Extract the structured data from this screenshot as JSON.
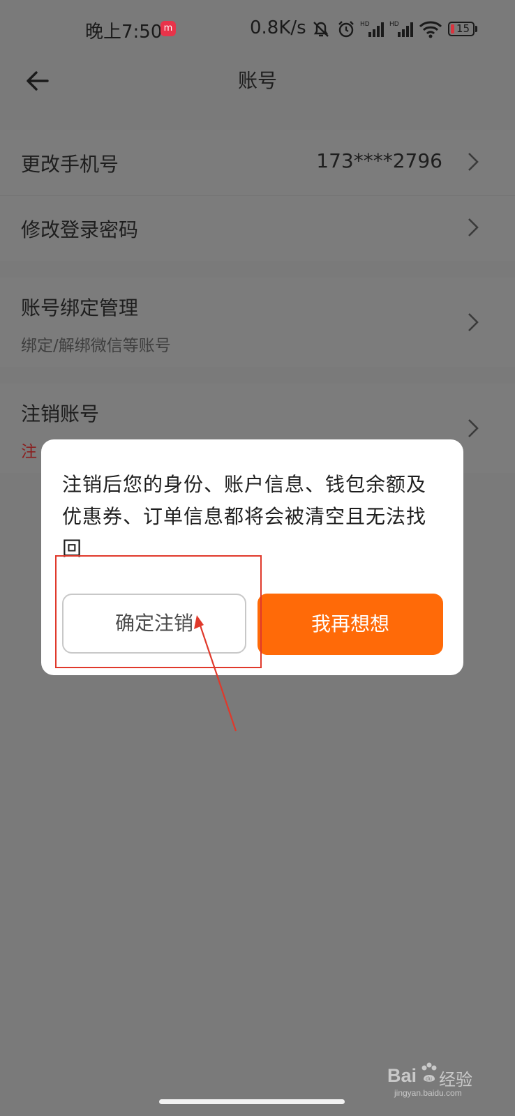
{
  "status_bar": {
    "time": "晚上7:50",
    "app_badge": "m",
    "net_speed": "0.8K/s",
    "battery_level": "15",
    "icons": [
      "mute-bell-icon",
      "alarm-icon",
      "hd-signal-icon",
      "hd-signal-icon",
      "wifi-icon",
      "battery-icon"
    ]
  },
  "nav": {
    "title": "账号",
    "back_icon": "back-arrow-icon"
  },
  "rows": {
    "phone": {
      "label": "更改手机号",
      "value": "173****2796"
    },
    "password": {
      "label": "修改登录密码"
    },
    "binding": {
      "label": "账号绑定管理",
      "subtitle": "绑定/解绑微信等账号"
    },
    "delete": {
      "label": "注销账号",
      "subtitle_visible": "注"
    }
  },
  "dialog": {
    "message": "注销后您的身份、账户信息、钱包余额及优惠券、订单信息都将会被清空且无法找回",
    "confirm_label": "确定注销",
    "cancel_label": "我再想想"
  },
  "colors": {
    "accent": "#ff6a08",
    "annotation": "#e0392b",
    "overlay_bg": "#7a7a7a"
  },
  "watermark": {
    "brand": "Bai",
    "brand_cn": "经验",
    "url": "jingyan.baidu.com"
  }
}
